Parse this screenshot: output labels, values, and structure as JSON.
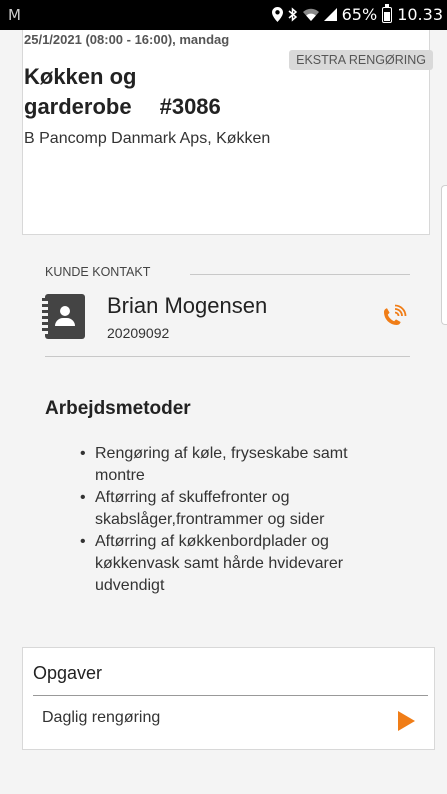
{
  "status_bar": {
    "left_icon": "M",
    "battery_percent": "65%",
    "time": "10.33",
    "icons": [
      "location-icon",
      "bluetooth-icon",
      "wifi-icon",
      "signal-icon",
      "battery-icon"
    ]
  },
  "job": {
    "date_line": "25/1/2021 (08:00 - 16:00), mandag",
    "tag": "EKSTRA RENGØRING",
    "title": "Køkken og garderobe",
    "number": "#3086",
    "subtitle": "B Pancomp Danmark Aps, Køkken"
  },
  "contact": {
    "label": "KUNDE KONTAKT",
    "name": "Brian Mogensen",
    "phone": "20209092",
    "icon": "contact-book-icon",
    "call_icon": "phone-call-icon"
  },
  "methods": {
    "title": "Arbejdsmetoder",
    "items": [
      "Rengøring af køle, fryseskabe samt montre",
      "Aftørring af skuffefronter og skabslåger,frontrammer og sider",
      "Aftørring af køkkenbordplader og køkkenvask samt hårde hvidevarer udvendigt"
    ]
  },
  "tasks": {
    "title": "Opgaver",
    "items": [
      {
        "label": "Daglig rengøring",
        "icon": "play-icon"
      }
    ]
  },
  "colors": {
    "accent": "#f07d17",
    "background": "#f4f4f4",
    "tag_bg": "#d9d9d9"
  }
}
